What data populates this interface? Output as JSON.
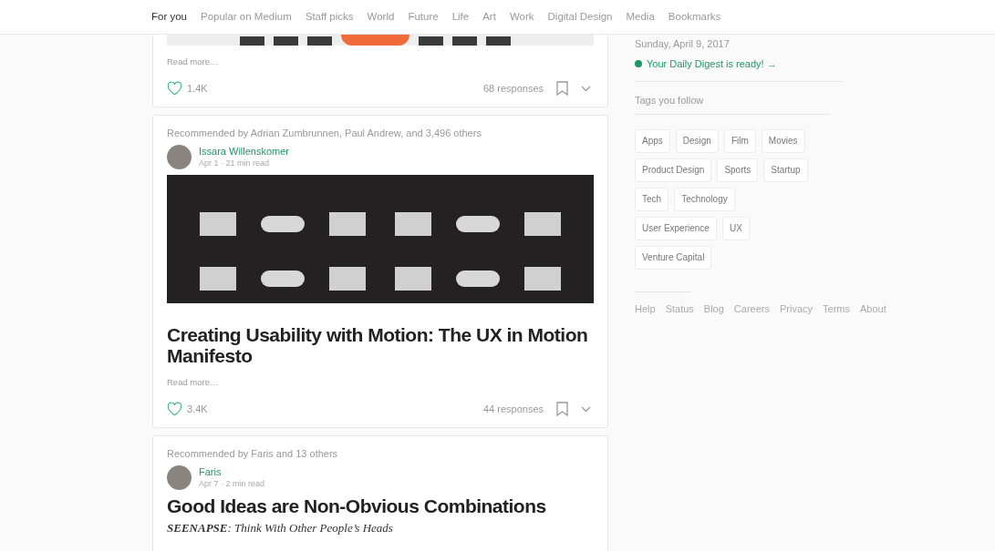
{
  "nav": {
    "tabs": [
      {
        "label": "For you",
        "selected": true
      },
      {
        "label": "Popular on Medium",
        "selected": false
      },
      {
        "label": "Staff picks",
        "selected": false
      },
      {
        "label": "World",
        "selected": false
      },
      {
        "label": "Future",
        "selected": false
      },
      {
        "label": "Life",
        "selected": false
      },
      {
        "label": "Art",
        "selected": false
      },
      {
        "label": "Work",
        "selected": false
      },
      {
        "label": "Digital Design",
        "selected": false
      },
      {
        "label": "Media",
        "selected": false
      },
      {
        "label": "Bookmarks",
        "selected": false
      }
    ]
  },
  "feed": [
    {
      "kind": "strip",
      "read_more": "Read more…",
      "likes": "1.4K",
      "responses": "68 responses"
    },
    {
      "recommended": "Recommended by Adrian Zumbrunnen, Paul Andrew, and 3,496 others",
      "author": "Issara Willenskomer",
      "meta": "Apr 1 · 21 min read",
      "kind": "grid",
      "title": "Creating Usability with Motion: The UX in Motion Manifesto",
      "read_more": "Read more…",
      "likes": "3.4K",
      "responses": "44 responses"
    },
    {
      "recommended": "Recommended by Faris and 13 others",
      "author": "Faris",
      "meta": "Apr 7 · 2 min read",
      "kind": "text",
      "title": "Good Ideas are Non-Obvious Combinations",
      "subtitle": "**SEENAPSE**: Think With Other People’s Heads"
    }
  ],
  "sidebar": {
    "date": "Sunday, April 9, 2017",
    "digest": "Your Daily Digest is ready! →",
    "tags_heading": "Tags you follow",
    "tags": [
      "Apps",
      "Design",
      "Film",
      "Movies",
      "Product Design",
      "Sports",
      "Startup",
      "Tech",
      "Technology",
      "User Experience",
      "UX",
      "Venture Capital"
    ],
    "footer_links": [
      "Help",
      "Status",
      "Blog",
      "Careers",
      "Privacy",
      "Terms",
      "About"
    ]
  }
}
